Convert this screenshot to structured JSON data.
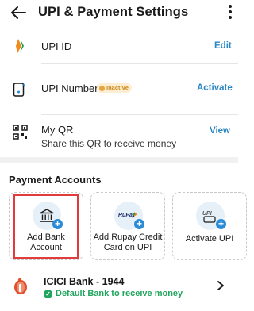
{
  "header": {
    "title": "UPI & Payment Settings",
    "back_icon": "arrow-left-icon",
    "more_icon": "kebab-menu-icon"
  },
  "rows": {
    "upi_id": {
      "label": "UPI ID",
      "action": "Edit",
      "icon": "upi-logo-icon"
    },
    "upi_number": {
      "label": "UPI Number",
      "badge": "Inactive",
      "action": "Activate",
      "icon": "mobile-hash-icon"
    },
    "my_qr": {
      "label": "My QR",
      "subtitle": "Share this QR to receive money",
      "action": "View",
      "icon": "qr-code-icon"
    }
  },
  "payment_accounts": {
    "title": "Payment Accounts",
    "cards": [
      {
        "label": "Add Bank Account",
        "line1": "Add Bank",
        "line2": "Account",
        "icon": "bank-icon"
      },
      {
        "label": "Add Rupay Credit Card on UPI",
        "line1": "Add Rupay Credit",
        "line2": "Card on UPI",
        "icon": "rupay-card-icon",
        "logo_text": "RuPay"
      },
      {
        "label": "Activate UPI",
        "line1": "Activate UPI",
        "icon": "upi-phone-icon",
        "logo_text": "UPI"
      }
    ]
  },
  "bank": {
    "name": "ICICI Bank - 1944",
    "status": "Default Bank to receive money",
    "icon": "icici-logo-icon"
  },
  "colors": {
    "accent": "#2a86c4",
    "success": "#1fa55c",
    "warning_bg": "#fdeed3",
    "warning_fg": "#c98a1a",
    "highlight": "#e03c3c"
  }
}
